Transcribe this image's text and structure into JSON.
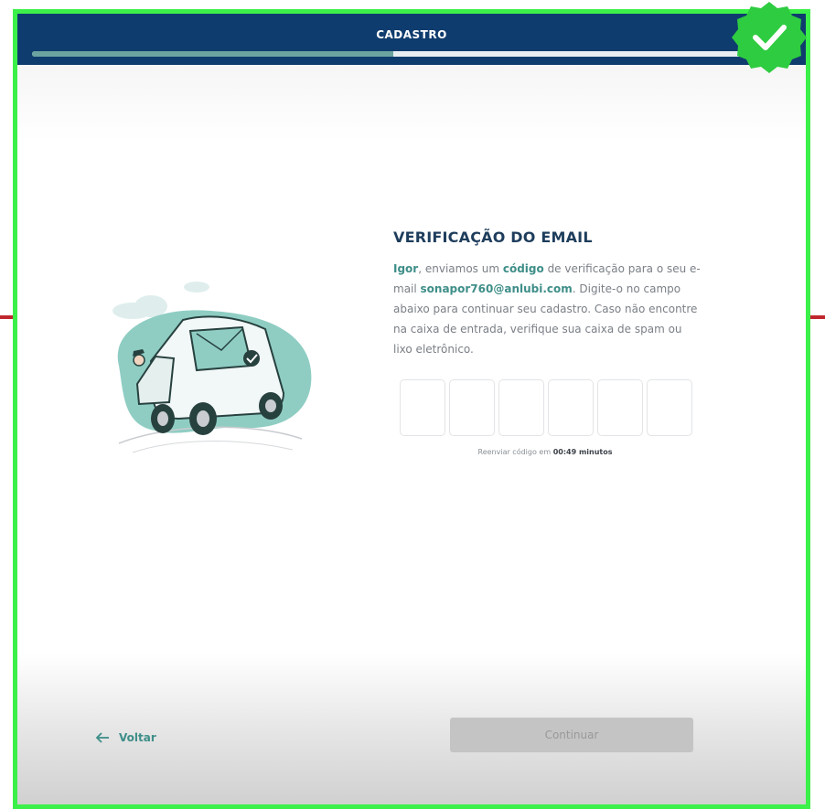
{
  "header": {
    "title": "CADASTRO",
    "progress": 0.5,
    "progress_color": "#6aa3a0",
    "bar_color": "#0f3c6e"
  },
  "badge": {
    "icon": "checkmark-icon",
    "color": "#2ecc40"
  },
  "main": {
    "illustration": "delivery-van-email-illustration",
    "heading": "VERIFICAÇÃO DO EMAIL",
    "message": {
      "name": "Igor",
      "part1": ", enviamos um ",
      "code_word": "código",
      "part2": " de verificação para o seu e-mail ",
      "email": "sonapor760@anlubi.com",
      "part3": ". Digite-o no campo abaixo para continuar seu cadastro. Caso não encontre na caixa de entrada, verifique sua caixa de spam ou lixo eletrônico."
    },
    "code_inputs": [
      "",
      "",
      "",
      "",
      "",
      ""
    ],
    "resend": {
      "prefix": "Reenviar código em",
      "time": "00:49 minutos"
    }
  },
  "footer": {
    "back_label": "Voltar",
    "back_icon": "arrow-left-icon",
    "continue_label": "Continuar"
  }
}
